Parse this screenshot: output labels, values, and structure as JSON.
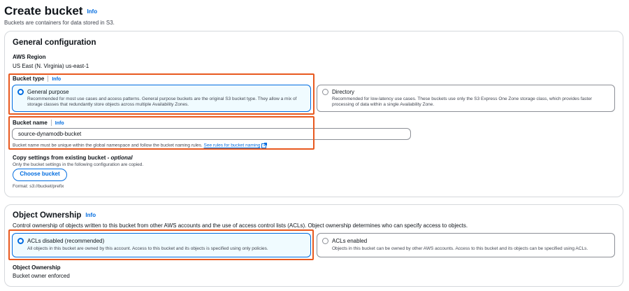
{
  "header": {
    "title": "Create bucket",
    "info": "Info",
    "subtitle": "Buckets are containers for data stored in S3."
  },
  "general": {
    "heading": "General configuration",
    "region_label": "AWS Region",
    "region_value": "US East (N. Virginia) us-east-1",
    "bucket_type_label": "Bucket type",
    "info": "Info",
    "options": [
      {
        "title": "General purpose",
        "desc": "Recommended for most use cases and access patterns. General purpose buckets are the original S3 bucket type. They allow a mix of storage classes that redundantly store objects across multiple Availability Zones.",
        "selected": true
      },
      {
        "title": "Directory",
        "desc": "Recommended for low-latency use cases. These buckets use only the S3 Express One Zone storage class, which provides faster processing of data within a single Availability Zone.",
        "selected": false
      }
    ],
    "bucket_name_label": "Bucket name",
    "bucket_name_value": "source-dynamodb-bucket",
    "bucket_name_hint": "Bucket name must be unique within the global namespace and follow the bucket naming rules.",
    "naming_link": "See rules for bucket naming",
    "copy_label": "Copy settings from existing bucket",
    "copy_optional": "- optional",
    "copy_hint": "Only the bucket settings in the following configuration are copied.",
    "choose_button": "Choose bucket",
    "format_hint": "Format: s3://bucket/prefix"
  },
  "ownership": {
    "heading": "Object Ownership",
    "info": "Info",
    "desc": "Control ownership of objects written to this bucket from other AWS accounts and the use of access control lists (ACLs). Object ownership determines who can specify access to objects.",
    "options": [
      {
        "title": "ACLs disabled (recommended)",
        "desc": "All objects in this bucket are owned by this account. Access to this bucket and its objects is specified using only policies.",
        "selected": true
      },
      {
        "title": "ACLs enabled",
        "desc": "Objects in this bucket can be owned by other AWS accounts. Access to this bucket and its objects can be specified using ACLs.",
        "selected": false
      }
    ],
    "ownership_label": "Object Ownership",
    "ownership_value": "Bucket owner enforced"
  },
  "colors": {
    "accent": "#006ce0",
    "highlight": "#e8591f",
    "selected_bg": "#f0fbff"
  }
}
